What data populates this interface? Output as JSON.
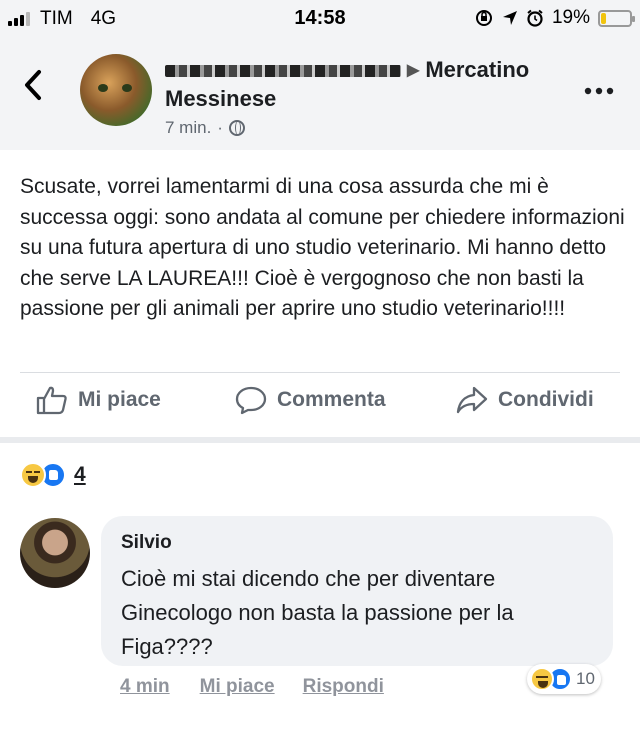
{
  "status_bar": {
    "carrier": "TIM",
    "network": "4G",
    "time": "14:58",
    "battery": "19%",
    "battery_level": 0.19,
    "battery_color": "#f1c40f"
  },
  "header": {
    "back_icon": "chevron-left-icon",
    "group_name": "Mercatino Messinese",
    "time_ago": "7 min.",
    "dot": "·",
    "privacy_icon": "globe-icon",
    "more_icon": "more-dots-icon"
  },
  "post": {
    "text": "Scusate, vorrei lamentarmi di una cosa assurda che mi è successa oggi: sono andata al comune per chiedere informazioni su una futura apertura di uno studio veterinario. Mi hanno detto che serve LA LAUREA!!! Cioè è vergognoso che non basti la passione per gli animali per aprire uno studio veterinario!!!!"
  },
  "actions": {
    "like": "Mi piace",
    "comment": "Commenta",
    "share": "Condividi"
  },
  "reactions": {
    "count": "4",
    "types": [
      "haha",
      "like"
    ]
  },
  "comment": {
    "author": "Silvio",
    "text": "Cioè mi stai dicendo che per diventare Ginecologo non basta la passione per la Figa????",
    "time": "4 min",
    "like": "Mi piace",
    "reply": "Rispondi",
    "reaction_count": "10"
  },
  "colors": {
    "brand_blue": "#1877f2",
    "muted_text": "#606770",
    "bubble_bg": "#f0f2f5"
  }
}
